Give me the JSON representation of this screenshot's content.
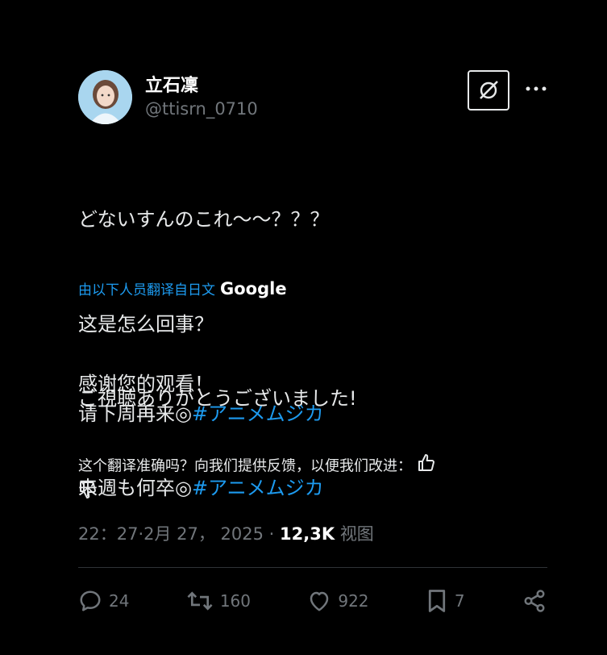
{
  "author": {
    "name": "立石凜",
    "handle": "@ttisrn_0710"
  },
  "tweet": {
    "line1": "どないすんのこれ～～？？？",
    "line2": "ご視聴ありがとうございました!",
    "line3_prefix": "来週も何卒◎",
    "hashtag": "#アニメムジカ"
  },
  "translation": {
    "label": "由以下人员翻译自日文",
    "provider": "Google",
    "line1": "这是怎么回事？",
    "line2": "感谢您的观看！",
    "line3_prefix": "请下周再来◎",
    "hashtag": "#アニメムジカ"
  },
  "feedback": {
    "text": "这个翻译准确吗？向我们提供反馈，以便我们改进："
  },
  "meta": {
    "timestamp": "22：27·2月 27， 2025",
    "separator": " · ",
    "views_count": "12,3K",
    "views_label": "视图"
  },
  "actions": {
    "replies": "24",
    "retweets": "160",
    "likes": "922",
    "bookmarks": "7"
  },
  "icons": {
    "grok": "grok-icon",
    "more": "more-icon",
    "reply": "reply-icon",
    "retweet": "retweet-icon",
    "like": "heart-icon",
    "bookmark": "bookmark-icon",
    "share": "share-icon",
    "thumbs_up": "thumbs-up-icon",
    "thumbs_down": "thumbs-down-icon"
  },
  "colors": {
    "background": "#000000",
    "text": "#e7e9ea",
    "muted": "#71767b",
    "link": "#1d9bf0"
  }
}
